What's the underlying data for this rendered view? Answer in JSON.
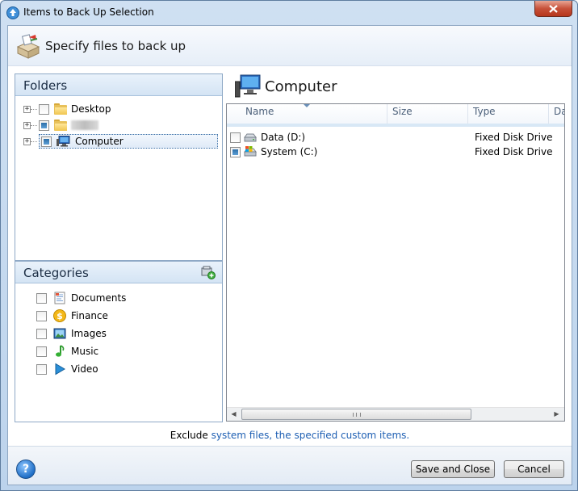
{
  "window": {
    "title": "Items to Back Up Selection"
  },
  "header": {
    "title": "Specify files to back up"
  },
  "folders": {
    "heading": "Folders",
    "items": [
      {
        "label": "Desktop",
        "checked": false
      },
      {
        "label": "",
        "checked": "partial"
      },
      {
        "label": "Computer",
        "checked": "partial",
        "selected": true
      }
    ]
  },
  "categories": {
    "heading": "Categories",
    "items": [
      {
        "label": "Documents",
        "icon": "document-icon"
      },
      {
        "label": "Finance",
        "icon": "finance-icon"
      },
      {
        "label": "Images",
        "icon": "image-icon"
      },
      {
        "label": "Music",
        "icon": "music-icon"
      },
      {
        "label": "Video",
        "icon": "video-icon"
      }
    ]
  },
  "content": {
    "title": "Computer",
    "columns": [
      "Name",
      "Size",
      "Type",
      "Da"
    ],
    "rows": [
      {
        "name": "Data (D:)",
        "type": "Fixed Disk Drive",
        "checked": false
      },
      {
        "name": "System (C:)",
        "type": "Fixed Disk Drive",
        "checked": "partial"
      }
    ]
  },
  "exclude": {
    "prefix": "Exclude ",
    "link1": "system files,",
    "link2": " the specified custom items."
  },
  "buttons": {
    "save": "Save and Close",
    "cancel": "Cancel"
  },
  "colors": {
    "accent": "#1e5fb3",
    "selection": "#2d6fa8",
    "close": "#c7513a"
  }
}
